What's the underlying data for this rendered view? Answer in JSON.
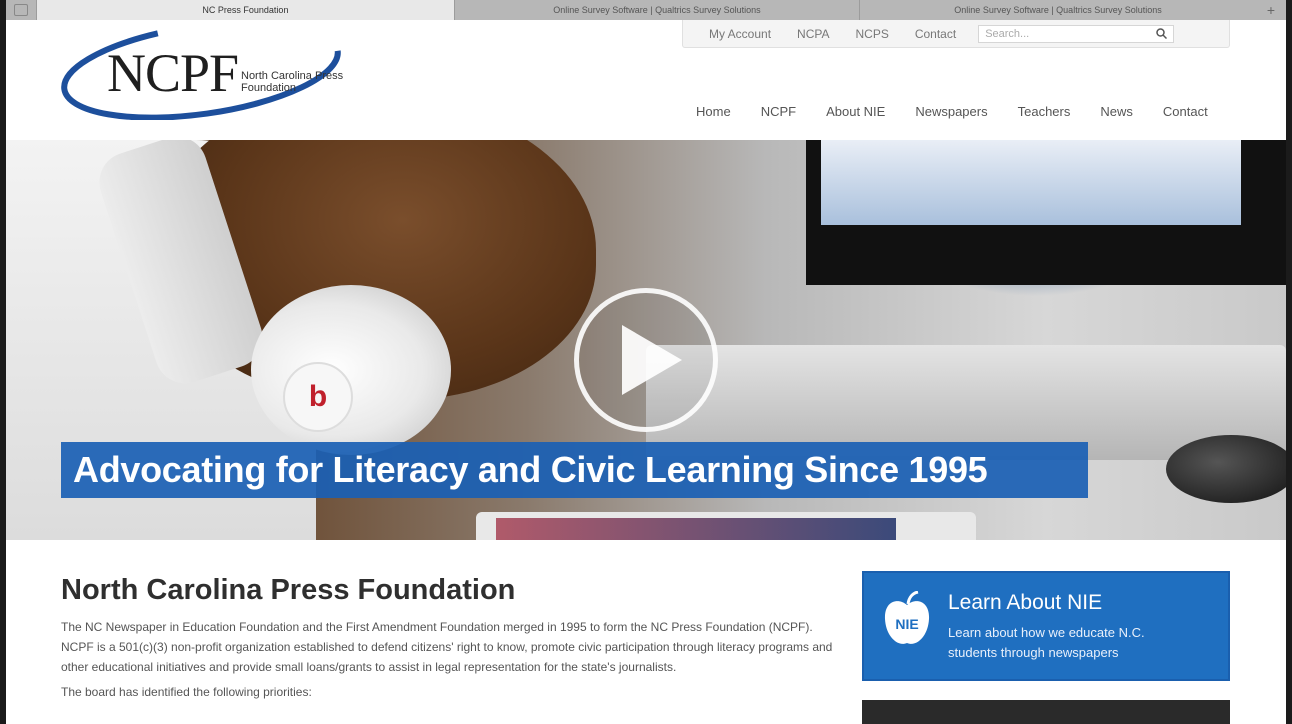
{
  "browser": {
    "tabs": [
      {
        "title": "NC Press Foundation",
        "active": true
      },
      {
        "title": "Online Survey Software | Qualtrics Survey Solutions",
        "active": false
      },
      {
        "title": "Online Survey Software | Qualtrics Survey Solutions",
        "active": false
      }
    ]
  },
  "header": {
    "logo_main": "NCPF",
    "logo_sub": "North Carolina Press Foundation",
    "utility_links": [
      "My Account",
      "NCPA",
      "NCPS",
      "Contact"
    ],
    "search_placeholder": "Search...",
    "nav": [
      "Home",
      "NCPF",
      "About NIE",
      "Newspapers",
      "Teachers",
      "News",
      "Contact"
    ]
  },
  "hero": {
    "banner_text": "Advocating for Literacy and Civic Learning Since 1995",
    "headphone_logo": "b",
    "play_icon": "play-icon"
  },
  "main": {
    "title": "North Carolina Press Foundation",
    "paragraph": "The NC Newspaper in Education Foundation and the First Amendment Foundation merged in 1995 to form the NC Press Foundation (NCPF). NCPF is a 501(c)(3) non-profit organization established to defend citizens' right to know, promote civic participation through literacy programs and other educational initiatives and provide small loans/grants to assist in legal representation for the state's journalists.",
    "more": "The board has identified the following priorities:"
  },
  "sidebar": {
    "nie_card": {
      "title": "Learn About NIE",
      "description": "Learn about how we educate N.C. students through newspapers",
      "icon": "apple-nie-icon",
      "icon_text": "NIE"
    }
  },
  "colors": {
    "brand_blue": "#1f6fc0",
    "banner_blue": "#1a5fb4"
  }
}
